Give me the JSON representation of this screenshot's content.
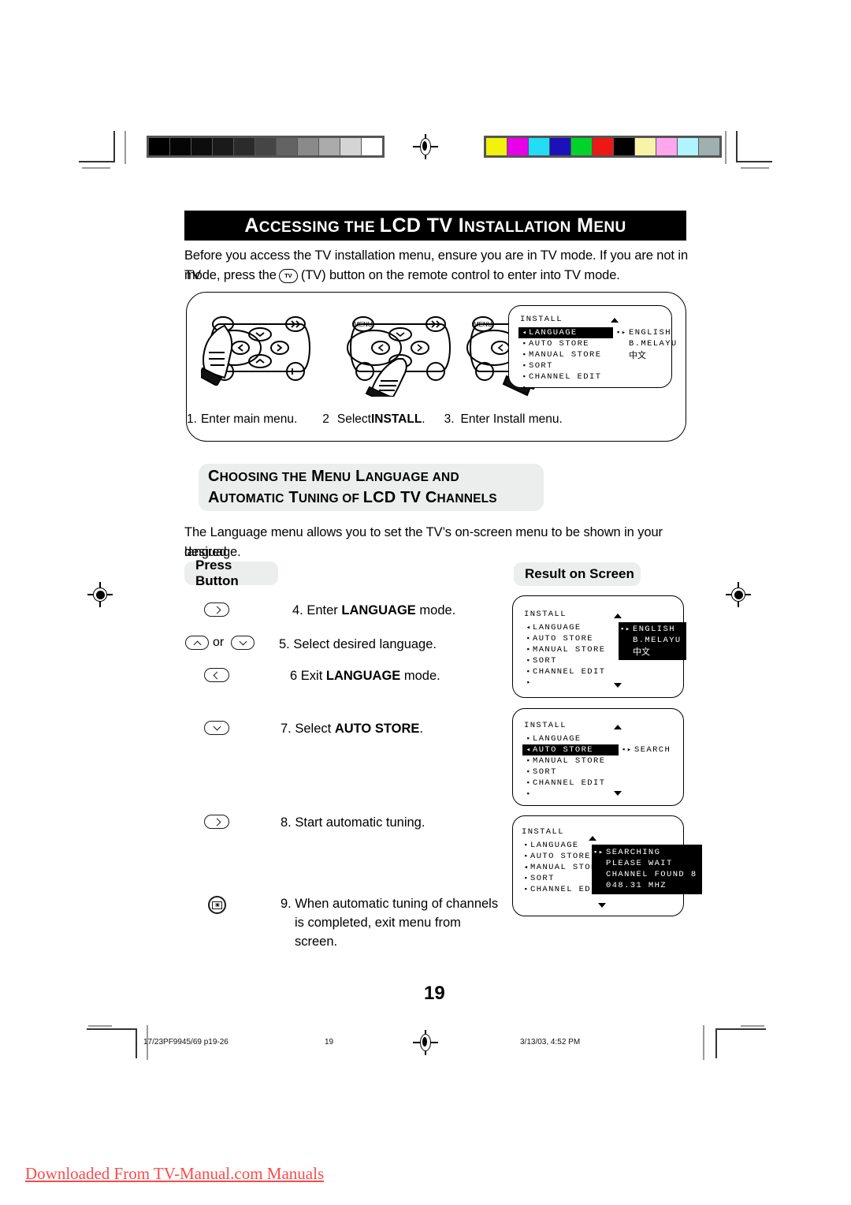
{
  "page": {
    "number": "19",
    "footer_left": "17/23PF9945/69 p19-26",
    "footer_center": "19",
    "footer_right": "3/13/03, 4:52 PM",
    "watermark": "Downloaded From TV-Manual.com Manuals"
  },
  "section1": {
    "title_parts": {
      "a": "A",
      "b": "CCESSING",
      "c": " ",
      "d": "THE",
      "e": " LCD TV I",
      "f": "NSTALLATION",
      "g": " M",
      "h": "ENU"
    },
    "title_plain": "ACCESSING THE LCD TV INSTALLATION MENU",
    "intro_line1": "Before you access the TV installation menu, ensure you are in TV mode. If you are not in TV",
    "intro_line2_before": "mode, press the",
    "intro_tv_button": "TV",
    "intro_line2_after": "(TV) button on the remote control to enter into TV mode."
  },
  "steps_top": [
    {
      "num": "1.",
      "label": "Enter main menu."
    },
    {
      "num": "2",
      "label_pre": "Select ",
      "label_bold": "INSTALL",
      "label_post": "."
    },
    {
      "num": "3.",
      "label": "Enter Install menu."
    }
  ],
  "section2": {
    "heading_line1_a": "C",
    "heading_line1_b": "HOOSING",
    "heading_line1_c": "THE",
    "heading_line1_d": " M",
    "heading_line1_e": "ENU",
    "heading_line1_f": " L",
    "heading_line1_g": "ANGUAGE",
    "heading_line1_h": "AND",
    "heading_line1_plain": "CHOOSING THE MENU LANGUAGE AND",
    "heading_line2_plain": "AUTOMATIC TUNING OF LCD TV CHANNELS",
    "body_line1": "The Language menu allows you to set the TV’s on-screen menu to be  shown in your desired",
    "body_line2": "language."
  },
  "columns": {
    "press_button": "Press Button",
    "result_on_screen": "Result on Screen"
  },
  "steps": [
    {
      "num": "4.",
      "key": "right-arrow-key",
      "text_pre": "Enter ",
      "text_bold": "LANGUAGE",
      "text_post": " mode."
    },
    {
      "num": "5.",
      "key": "up-down-arrow-keys",
      "or": "or",
      "text_pre": "Select desired language.",
      "text_bold": "",
      "text_post": ""
    },
    {
      "num": "6",
      "key": "left-arrow-key",
      "text_pre": "Exit ",
      "text_bold": "LANGUAGE",
      "text_post": " mode."
    },
    {
      "num": "7.",
      "key": "down-arrow-key",
      "text_pre": "Select ",
      "text_bold": "AUTO STORE",
      "text_post": "."
    },
    {
      "num": "8.",
      "key": "right-arrow-key",
      "text_pre": "Start automatic tuning.",
      "text_bold": "",
      "text_post": ""
    },
    {
      "num": "9.",
      "key": "menu-key",
      "text_pre": "When automatic tuning of channels",
      "text_bold": "",
      "text_post": "",
      "text_line2": "is completed, exit menu from screen."
    }
  ],
  "osd_screens": [
    {
      "id": "osd-install-language-top",
      "header": "INSTALL",
      "menu": [
        {
          "bullet": "◂",
          "label": "LANGUAGE",
          "selected": true
        },
        {
          "bullet": "▪",
          "label": "AUTO STORE",
          "selected": false
        },
        {
          "bullet": "▪",
          "label": "MANUAL STORE",
          "selected": false
        },
        {
          "bullet": "▪",
          "label": "SORT",
          "selected": false
        },
        {
          "bullet": "▪",
          "label": "CHANNEL EDIT",
          "selected": false
        },
        {
          "bullet": "▪",
          "label": "",
          "selected": false
        }
      ],
      "values_inverted": false,
      "values": [
        {
          "marker": "▪▸",
          "label": "ENGLISH",
          "cjk": false
        },
        {
          "marker": "",
          "label": "B.MELAYU",
          "cjk": false
        },
        {
          "marker": "",
          "label": "中文",
          "cjk": true
        }
      ],
      "arrow_up": true,
      "arrow_down": false
    },
    {
      "id": "osd-language-values",
      "header": "INSTALL",
      "menu": [
        {
          "bullet": "◂",
          "label": "LANGUAGE",
          "selected": false
        },
        {
          "bullet": "▪",
          "label": "AUTO STORE",
          "selected": false
        },
        {
          "bullet": "▪",
          "label": "MANUAL STORE",
          "selected": false
        },
        {
          "bullet": "▪",
          "label": "SORT",
          "selected": false
        },
        {
          "bullet": "▪",
          "label": "CHANNEL EDIT",
          "selected": false
        },
        {
          "bullet": "▪",
          "label": "",
          "selected": false
        }
      ],
      "values_inverted": true,
      "values": [
        {
          "marker": "▪▸",
          "label": "ENGLISH",
          "cjk": false
        },
        {
          "marker": "",
          "label": "B.MELAYU",
          "cjk": false
        },
        {
          "marker": "",
          "label": "中文",
          "cjk": true
        }
      ],
      "arrow_up": true,
      "arrow_down": true
    },
    {
      "id": "osd-auto-store-search",
      "header": "INSTALL",
      "menu": [
        {
          "bullet": "▪",
          "label": "LANGUAGE",
          "selected": false
        },
        {
          "bullet": "◂",
          "label": "AUTO STORE",
          "selected": true
        },
        {
          "bullet": "▪",
          "label": "MANUAL STORE",
          "selected": false
        },
        {
          "bullet": "▪",
          "label": "SORT",
          "selected": false
        },
        {
          "bullet": "▪",
          "label": "CHANNEL EDIT",
          "selected": false
        },
        {
          "bullet": "▪",
          "label": "",
          "selected": false
        }
      ],
      "values_inverted": false,
      "values": [
        {
          "marker": "▪▸",
          "label": "SEARCH",
          "cjk": false
        }
      ],
      "arrow_up": true,
      "arrow_down": true
    },
    {
      "id": "osd-searching",
      "header": "INSTALL",
      "menu": [
        {
          "bullet": "▪",
          "label": "LANGUAGE",
          "selected": false
        },
        {
          "bullet": "▪",
          "label": "AUTO STORE",
          "selected": false
        },
        {
          "bullet": "◂",
          "label": "MANUAL STORE",
          "selected": false
        },
        {
          "bullet": "▪",
          "label": "SORT",
          "selected": false
        },
        {
          "bullet": "▪",
          "label": "CHANNEL EDIT",
          "selected": false
        }
      ],
      "values_inverted": true,
      "values": [
        {
          "marker": "▪▸",
          "label": "SEARCHING",
          "cjk": false
        },
        {
          "marker": "",
          "label": "PLEASE WAIT",
          "cjk": false
        },
        {
          "marker": "",
          "label": "CHANNEL FOUND 8",
          "cjk": false
        },
        {
          "marker": "",
          "label": "048.31 MHZ",
          "cjk": false
        }
      ],
      "arrow_up": true,
      "arrow_down": true
    }
  ],
  "calibration": {
    "gray_ramp": [
      "#000000",
      "#050505",
      "#0d0d0d",
      "#1a1a1a",
      "#2b2b2b",
      "#454545",
      "#636363",
      "#8a8a8a",
      "#ababab",
      "#d4d4d4",
      "#ffffff"
    ],
    "color_bars": [
      "#f2f20d",
      "#e800e8",
      "#22ddf5",
      "#1a12b8",
      "#00d42b",
      "#ef1616",
      "#000000",
      "#f7f4a8",
      "#ffa6ef",
      "#b0f4ff",
      "#9fb0b0"
    ]
  }
}
